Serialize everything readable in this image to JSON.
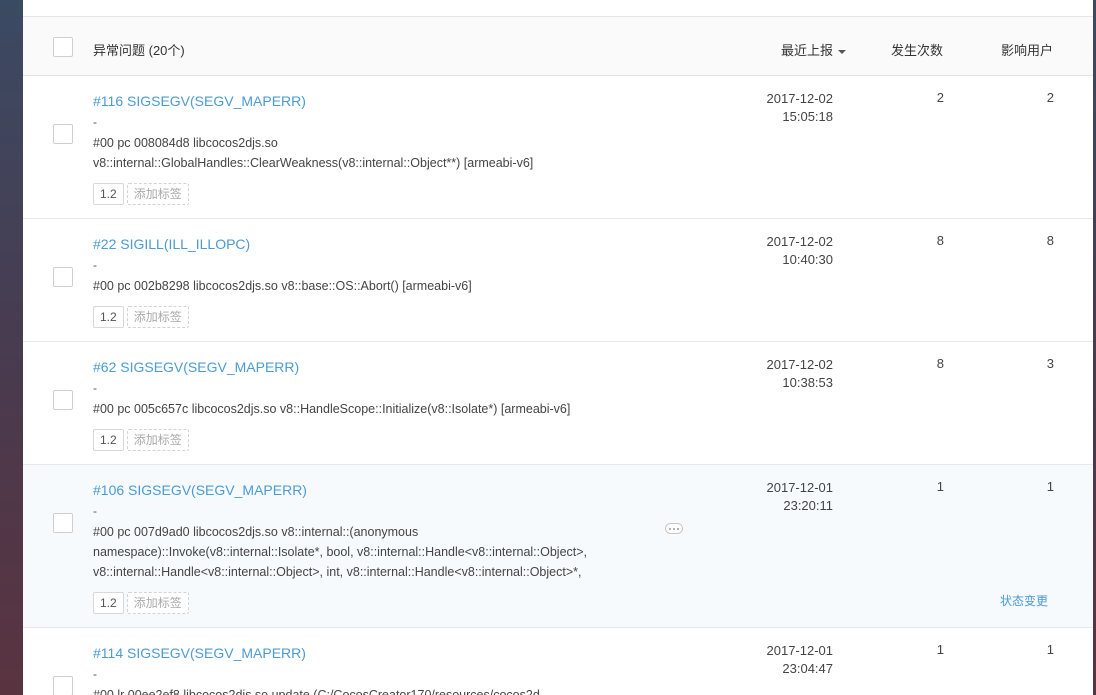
{
  "header": {
    "title": "异常问题 (20个)",
    "sort_label": "最近上报",
    "count_label": "发生次数",
    "users_label": "影响用户"
  },
  "issues": [
    {
      "title": "#116 SIGSEGV(SEGV_MAPERR)",
      "dash": "-",
      "stack": [
        "#00 pc 008084d8 libcocos2djs.so",
        "v8::internal::GlobalHandles::ClearWeakness(v8::internal::Object**) [armeabi-v6]"
      ],
      "version": "1.2",
      "add_tag": "添加标签",
      "date": "2017-12-02",
      "time": "15:05:18",
      "count": "2",
      "users": "2"
    },
    {
      "title": "#22 SIGILL(ILL_ILLOPC)",
      "dash": "-",
      "stack": [
        "#00 pc 002b8298 libcocos2djs.so v8::base::OS::Abort() [armeabi-v6]"
      ],
      "version": "1.2",
      "add_tag": "添加标签",
      "date": "2017-12-02",
      "time": "10:40:30",
      "count": "8",
      "users": "8"
    },
    {
      "title": "#62 SIGSEGV(SEGV_MAPERR)",
      "dash": "-",
      "stack": [
        "#00 pc 005c657c libcocos2djs.so v8::HandleScope::Initialize(v8::Isolate*) [armeabi-v6]"
      ],
      "version": "1.2",
      "add_tag": "添加标签",
      "date": "2017-12-02",
      "time": "10:38:53",
      "count": "8",
      "users": "3"
    },
    {
      "title": "#106 SIGSEGV(SEGV_MAPERR)",
      "dash": "-",
      "stack": [
        "#00 pc 007d9ad0 libcocos2djs.so v8::internal::(anonymous",
        "namespace)::Invoke(v8::internal::Isolate*, bool, v8::internal::Handle<v8::internal::Object>,",
        "v8::internal::Handle<v8::internal::Object>, int, v8::internal::Handle<v8::internal::Object>*,"
      ],
      "version": "1.2",
      "add_tag": "添加标签",
      "date": "2017-12-01",
      "time": "23:20:11",
      "count": "1",
      "users": "1",
      "status_link": "状态变更"
    },
    {
      "title": "#114 SIGSEGV(SEGV_MAPERR)",
      "dash": "-",
      "stack": [
        "#00 lr 00ee2ef8 libcocos2djs.so update (C:/CocosCreator170/resources/cocos2d"
      ],
      "date": "2017-12-01",
      "time": "23:04:47",
      "count": "1",
      "users": "1"
    }
  ]
}
